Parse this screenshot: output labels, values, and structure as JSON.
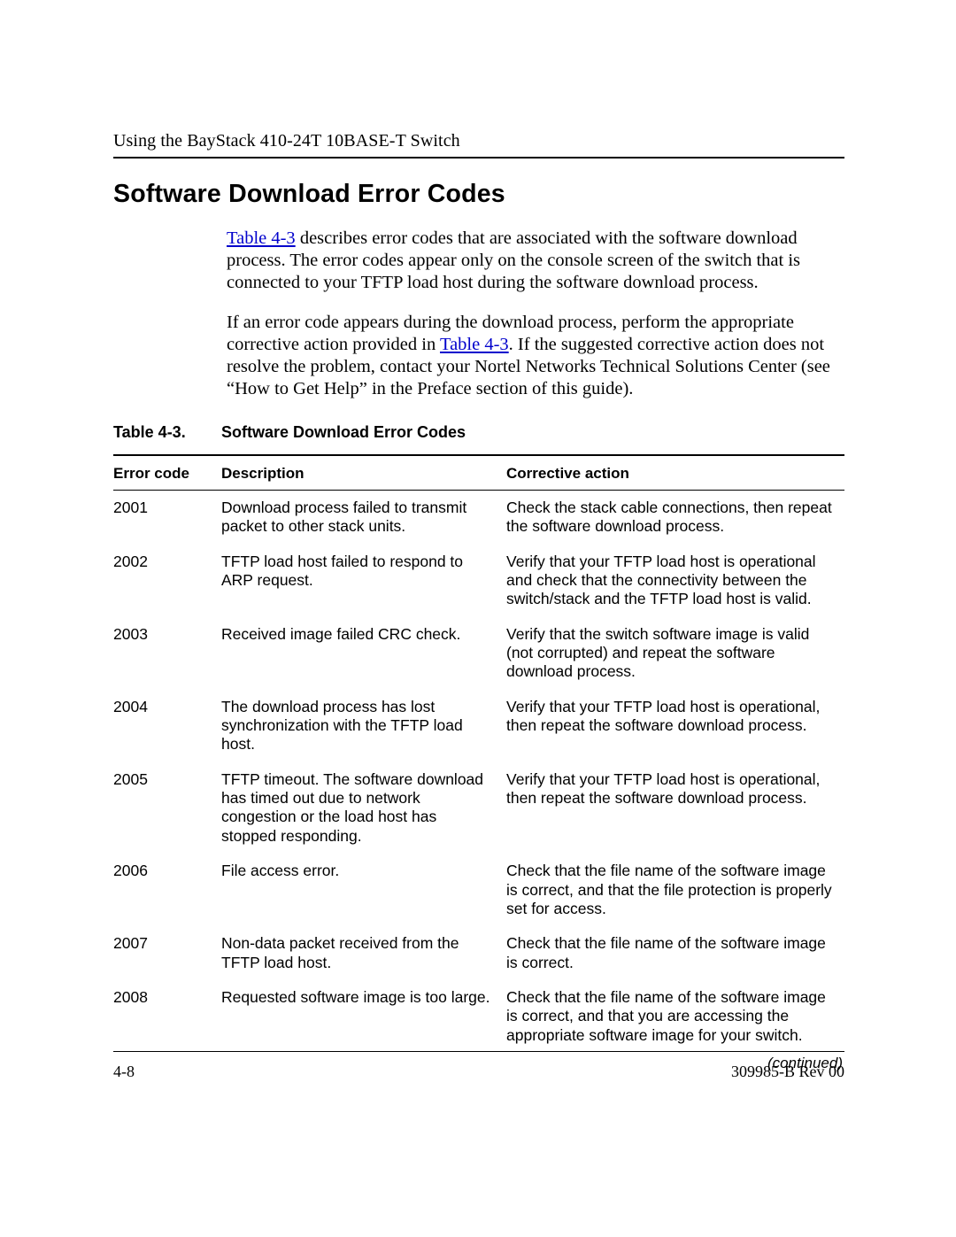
{
  "running_head": "Using the BayStack 410-24T 10BASE-T Switch",
  "heading": "Software Download Error Codes",
  "para1_pre": "",
  "link1": "Table 4-3",
  "para1_post": " describes error codes that are associated with the software download process. The error codes appear only on the console screen of the switch that is connected to your TFTP load host during the software download process.",
  "para2_pre": "If an error code appears during the download process, perform the appropriate corrective action provided in ",
  "link2": "Table 4-3",
  "para2_post": ". If the suggested corrective action does not resolve the problem, contact your Nortel Networks Technical Solutions Center (see “How to Get Help” in the Preface section of this guide).",
  "table": {
    "number": "Table 4-3.",
    "title": "Software Download Error Codes",
    "headers": {
      "code": "Error code",
      "desc": "Description",
      "action": "Corrective action"
    },
    "rows": [
      {
        "code": "2001",
        "desc": "Download process failed to transmit packet to other stack units.",
        "action": "Check the stack cable connections, then repeat the software download process."
      },
      {
        "code": "2002",
        "desc": "TFTP load host failed to respond to ARP request.",
        "action": "Verify that your TFTP load host is operational and check that the connectivity between the switch/stack and the TFTP load host is valid."
      },
      {
        "code": "2003",
        "desc": "Received image failed CRC check.",
        "action": "Verify that the switch software image is valid (not corrupted) and repeat the software download process."
      },
      {
        "code": "2004",
        "desc": "The download process has lost synchronization with the TFTP load host.",
        "action": "Verify that your TFTP load host is operational, then repeat the software download process."
      },
      {
        "code": "2005",
        "desc": "TFTP timeout. The software download has timed out due to network congestion or the load host has stopped responding.",
        "action": "Verify that your TFTP load host is operational, then repeat the software download process."
      },
      {
        "code": "2006",
        "desc": "File access error.",
        "action": "Check that the file name of the software image is correct, and that the file protection is properly set for access."
      },
      {
        "code": "2007",
        "desc": "Non-data packet received from the TFTP load host.",
        "action": "Check that the file name of the software image is correct."
      },
      {
        "code": "2008",
        "desc": "Requested software image is too large.",
        "action": "Check that the file name of the software image is correct, and that you are accessing the appropriate software image for your switch."
      }
    ],
    "continued": "(continued)"
  },
  "footer": {
    "page": "4-8",
    "doc": "309985-B Rev 00"
  }
}
